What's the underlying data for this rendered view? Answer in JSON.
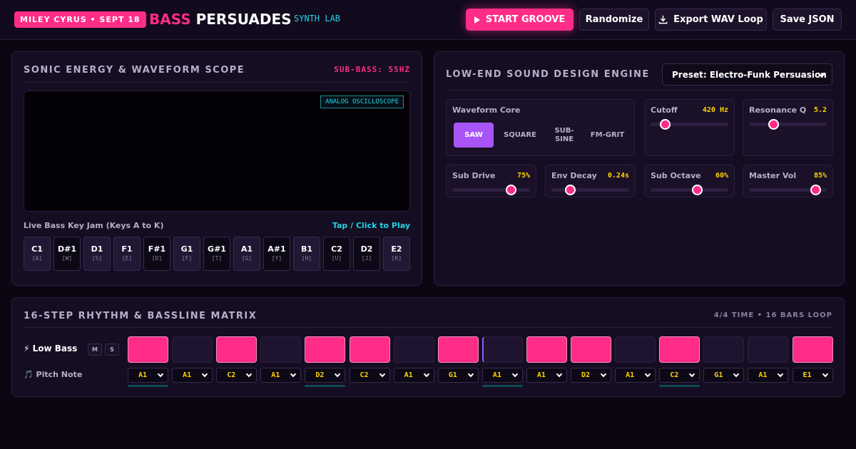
{
  "header": {
    "badge": "MILEY CYRUS • SEPT 18",
    "brand_accent": "BASS",
    "brand_main": "PERSUADES",
    "brand_sub": "SYNTH LAB",
    "start_label": "START GROOVE",
    "randomize_label": "Randomize",
    "export_label": "Export WAV Loop",
    "save_label": "Save JSON"
  },
  "scope_panel": {
    "title": "SONIC ENERGY & WAVEFORM SCOPE",
    "sub_bass": "SUB-BASS: 55HZ",
    "scope_tag": "ANALOG OSCILLOSCOPE",
    "jam_label": "Live Bass Key Jam (Keys A to K)",
    "jam_hint": "Tap / Click to Play",
    "keys": [
      {
        "note": "C1",
        "key": "[A]",
        "type": "white"
      },
      {
        "note": "D#1",
        "key": "[W]",
        "type": "black"
      },
      {
        "note": "D1",
        "key": "[S]",
        "type": "white"
      },
      {
        "note": "F1",
        "key": "[E]",
        "type": "white"
      },
      {
        "note": "F#1",
        "key": "[D]",
        "type": "black"
      },
      {
        "note": "G1",
        "key": "[F]",
        "type": "white"
      },
      {
        "note": "G#1",
        "key": "[T]",
        "type": "black"
      },
      {
        "note": "A1",
        "key": "[G]",
        "type": "white"
      },
      {
        "note": "A#1",
        "key": "[Y]",
        "type": "black"
      },
      {
        "note": "B1",
        "key": "[H]",
        "type": "white"
      },
      {
        "note": "C2",
        "key": "[U]",
        "type": "black"
      },
      {
        "note": "D2",
        "key": "[J]",
        "type": "black"
      },
      {
        "note": "E2",
        "key": "[K]",
        "type": "white"
      }
    ]
  },
  "engine_panel": {
    "title": "LOW-END SOUND DESIGN ENGINE",
    "preset": "Preset: Electro-Funk Persuasion",
    "waveform_label": "Waveform Core",
    "waveforms": [
      "SAW",
      "SQUARE",
      "SUB-SINE",
      "FM-GRIT"
    ],
    "active_waveform": "SAW",
    "params": [
      {
        "name": "cutoff",
        "label": "Cutoff",
        "value": "420 Hz",
        "level": 0.18
      },
      {
        "name": "resonance",
        "label": "Resonance Q",
        "value": "5.2",
        "level": 0.31
      },
      {
        "name": "sub-drive",
        "label": "Sub Drive",
        "value": "75%",
        "level": 0.75
      },
      {
        "name": "env-decay",
        "label": "Env Decay",
        "value": "0.24s",
        "level": 0.24
      },
      {
        "name": "sub-octave",
        "label": "Sub Octave",
        "value": "60%",
        "level": 0.6
      },
      {
        "name": "master-vol",
        "label": "Master Vol",
        "value": "85%",
        "level": 0.85
      }
    ]
  },
  "matrix_panel": {
    "title": "16-STEP RHYTHM & BASSLINE MATRIX",
    "meta": "4/4 TIME • 16 BARS LOOP",
    "row_label": "⚡ Low Bass",
    "mute": "M",
    "solo": "S",
    "pitch_label": "🎵 Pitch Note",
    "steps": [
      true,
      false,
      true,
      false,
      true,
      true,
      false,
      true,
      false,
      true,
      true,
      false,
      true,
      false,
      false,
      true
    ],
    "current_step": 9,
    "pitches": [
      "A1",
      "A1",
      "C2",
      "A1",
      "D2",
      "C2",
      "A1",
      "G1",
      "A1",
      "A1",
      "D2",
      "A1",
      "C2",
      "G1",
      "A1",
      "E1"
    ],
    "colors": {
      "accent": "#ff2d87",
      "cyan": "#22d3e6",
      "value": "#ffd500",
      "active_wave": "#a855f7"
    }
  }
}
